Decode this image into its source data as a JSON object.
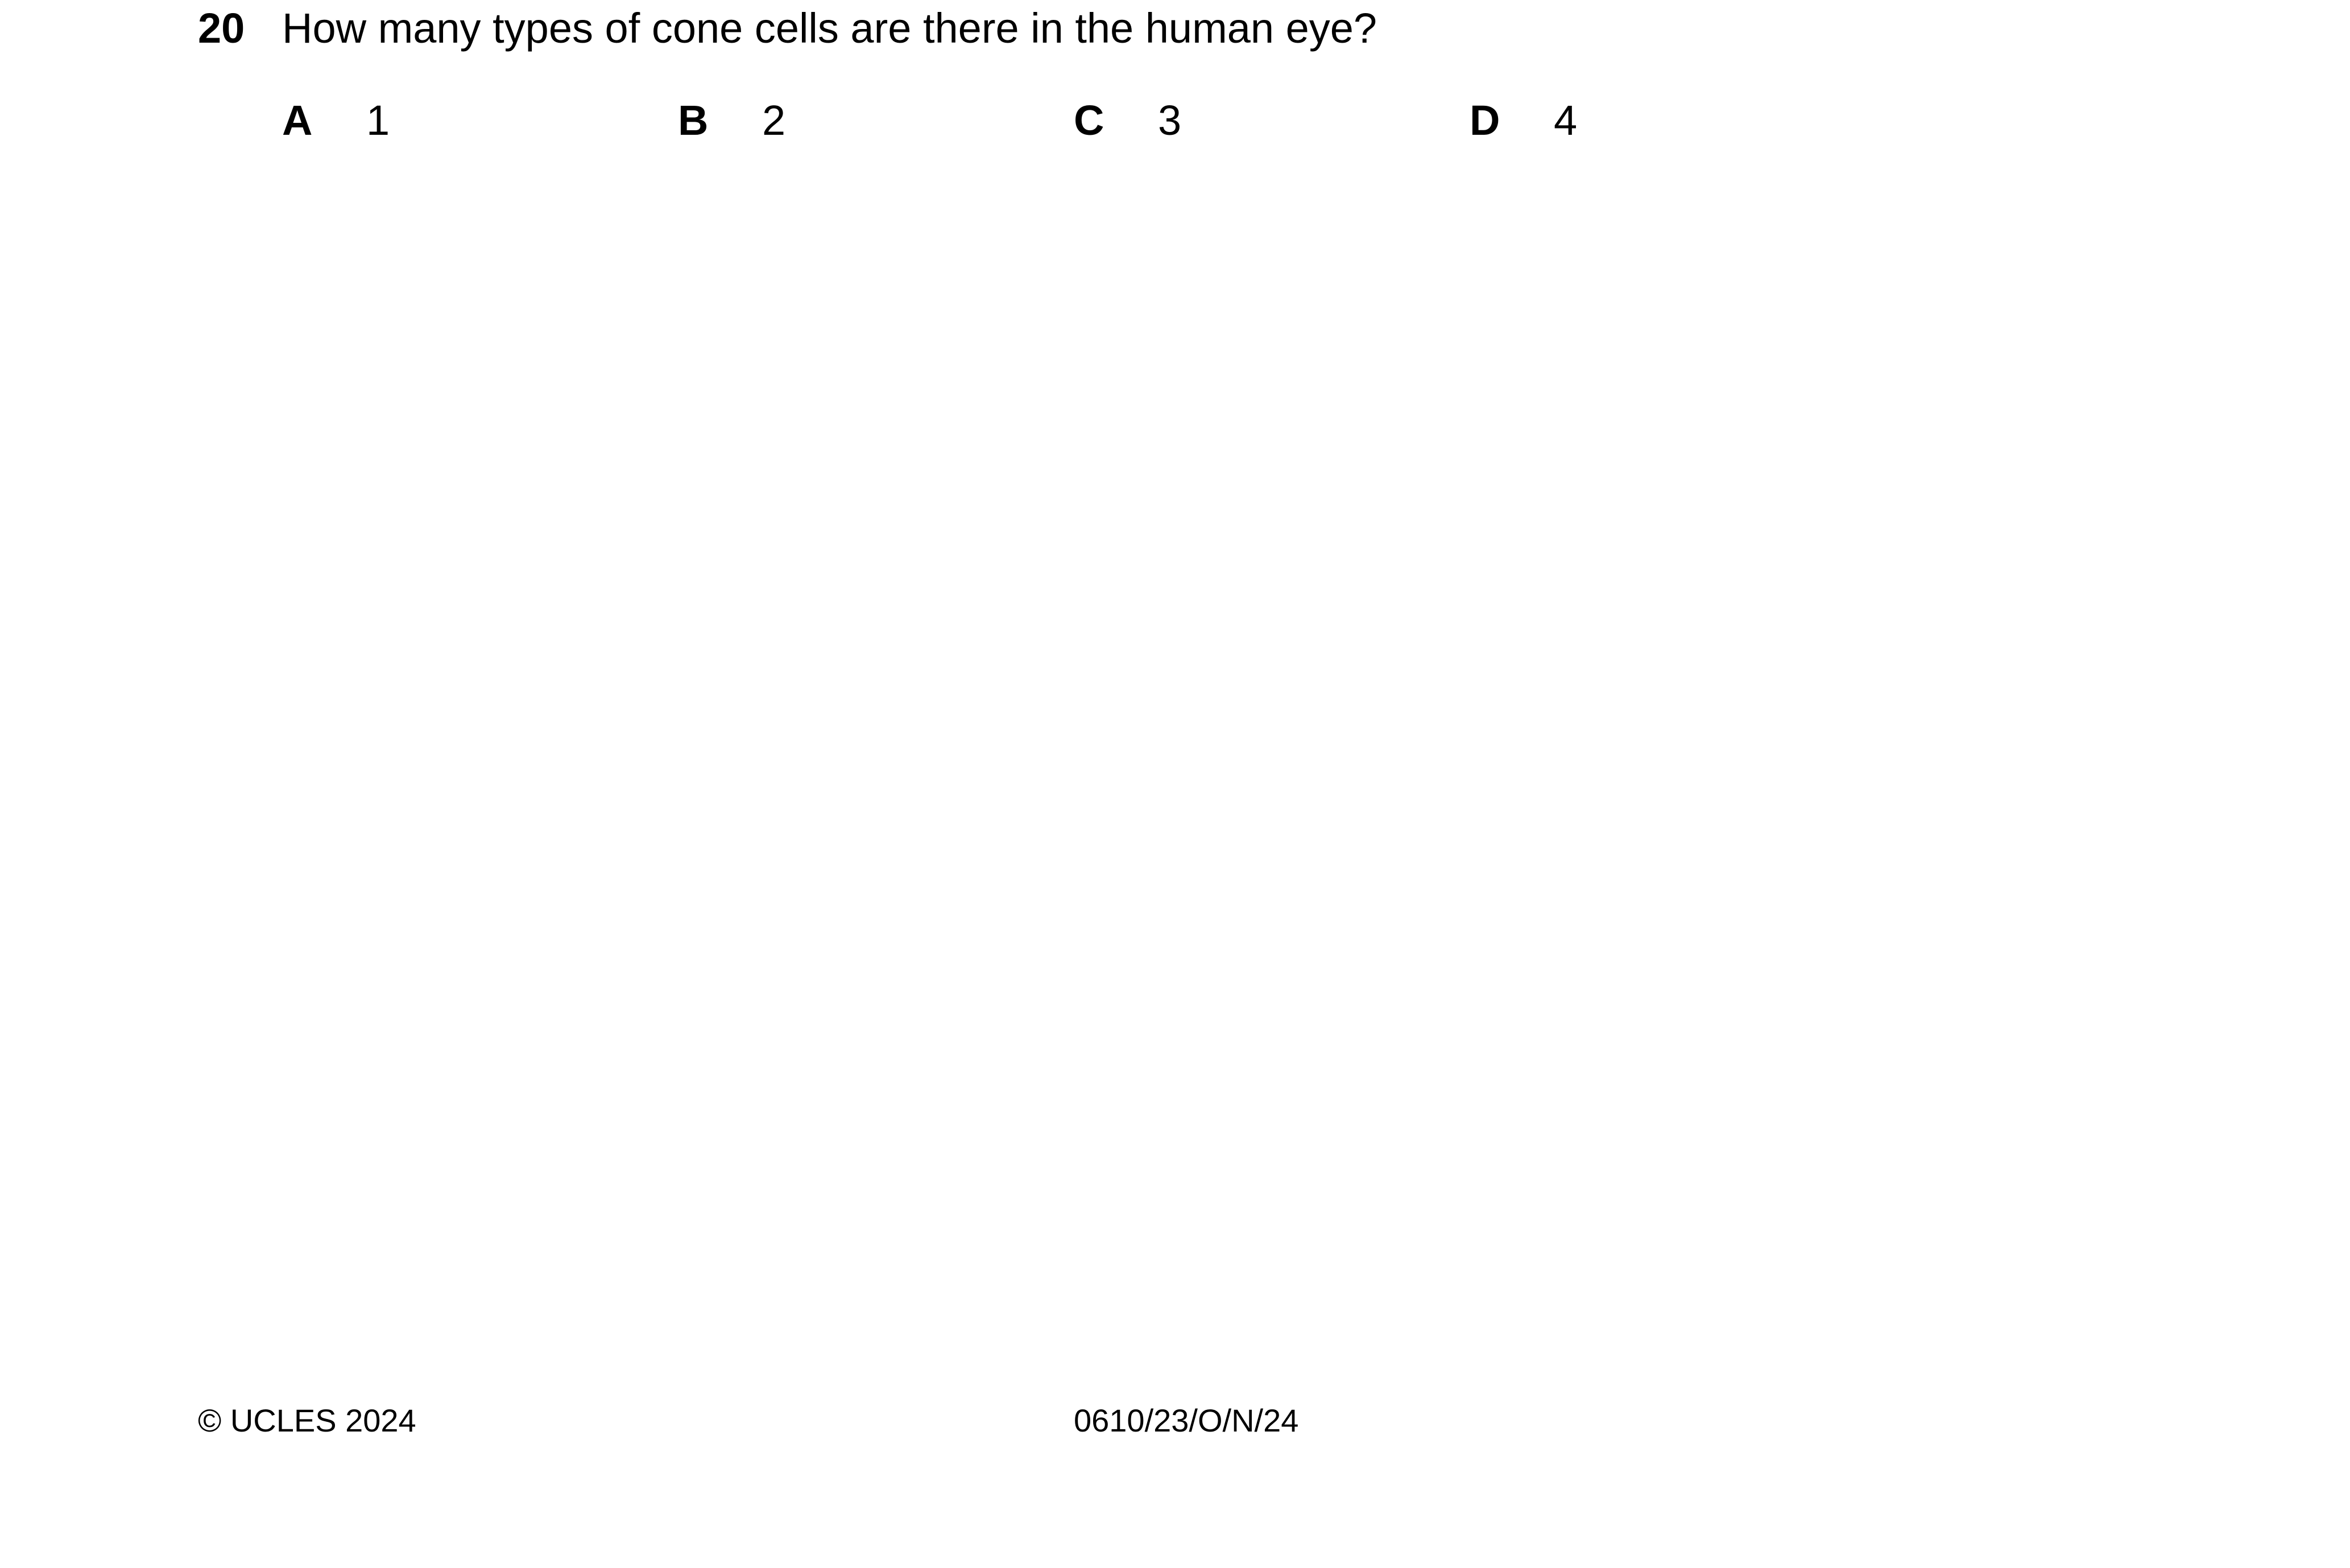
{
  "question": {
    "number": "20",
    "text": "How many types of cone cells are there in the human eye?",
    "options": [
      {
        "letter": "A",
        "value": "1"
      },
      {
        "letter": "B",
        "value": "2"
      },
      {
        "letter": "C",
        "value": "3"
      },
      {
        "letter": "D",
        "value": "4"
      }
    ]
  },
  "footer": {
    "copyright": "© UCLES 2024",
    "paper_code": "0610/23/O/N/24"
  }
}
